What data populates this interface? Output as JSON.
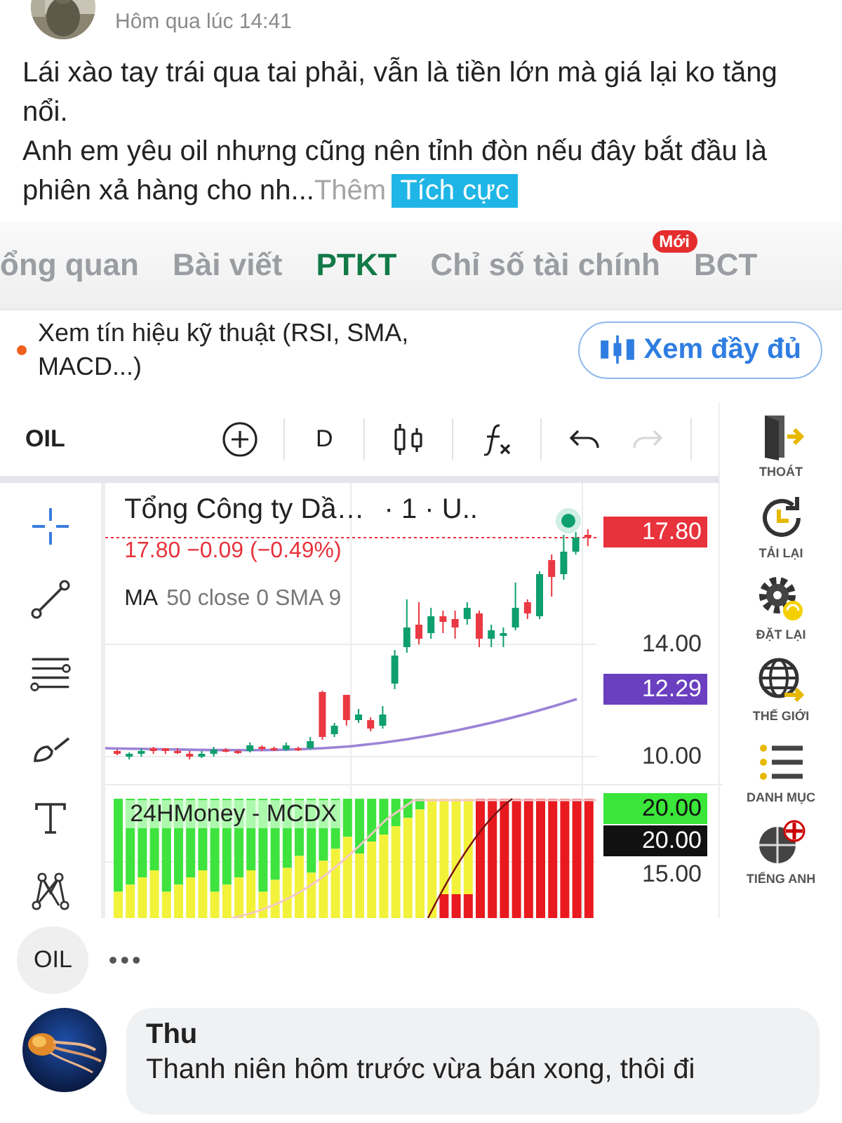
{
  "post": {
    "time": "Hôm qua lúc 14:41",
    "text_lines": [
      "Lái xào tay trái qua tai phải, vẫn là tiền lớn mà giá lại ko tăng nổi.",
      "Anh em yêu oil nhưng cũng nên tỉnh đòn nếu đây bắt đầu là phiên xả hàng cho nh..."
    ],
    "more_link": "Thêm",
    "sentiment_tag": "Tích cực"
  },
  "screenshot": {
    "tabs": [
      {
        "label": "ổng quan",
        "selected": false
      },
      {
        "label": "Bài viết",
        "selected": false
      },
      {
        "label": "PTKT",
        "selected": true
      },
      {
        "label": "Chỉ số tài chính",
        "selected": false,
        "badge": "Mới"
      },
      {
        "label": "BCT",
        "selected": false
      }
    ],
    "notice": {
      "text": "Xem tín hiệu kỹ thuật (RSI, SMA, MACD...)",
      "button": "Xem đầy đủ"
    },
    "toolbar": {
      "symbol": "OIL",
      "interval": "D",
      "redo_disabled": true
    },
    "chart": {
      "title": "Tổng Công ty Dầ…",
      "title_suffix": "· 1 · U..",
      "quote": "17.80 −0.09 (−0.49%)",
      "ma_label": "MA",
      "ma_params": "50 close 0 SMA 9",
      "price_labels": [
        {
          "text": "17.80",
          "kind": "tag",
          "color": "#e8323c"
        },
        {
          "text": "14.00",
          "kind": "axis"
        },
        {
          "text": "12.29",
          "kind": "tag",
          "color": "#6a3fc0"
        },
        {
          "text": "10.00",
          "kind": "axis"
        }
      ],
      "indicator": {
        "title": "24HMoney - MCDX",
        "labels": [
          {
            "text": "20.00",
            "kind": "tag",
            "color": "#39e639"
          },
          {
            "text": "20.00",
            "kind": "tag",
            "color": "#111111"
          },
          {
            "text": "15.00",
            "kind": "axis"
          }
        ]
      }
    },
    "right_tools": [
      "THOÁT",
      "TẢI LẠI",
      "ĐẶT LẠI",
      "THẾ GIỚI",
      "DANH MỤC",
      "TIẾNG ANH"
    ]
  },
  "tag_chip": "OIL",
  "more": "•••",
  "comment": {
    "author": "Thu",
    "text": "Thanh niên hôm trước vừa bán xong, thôi đi"
  }
}
